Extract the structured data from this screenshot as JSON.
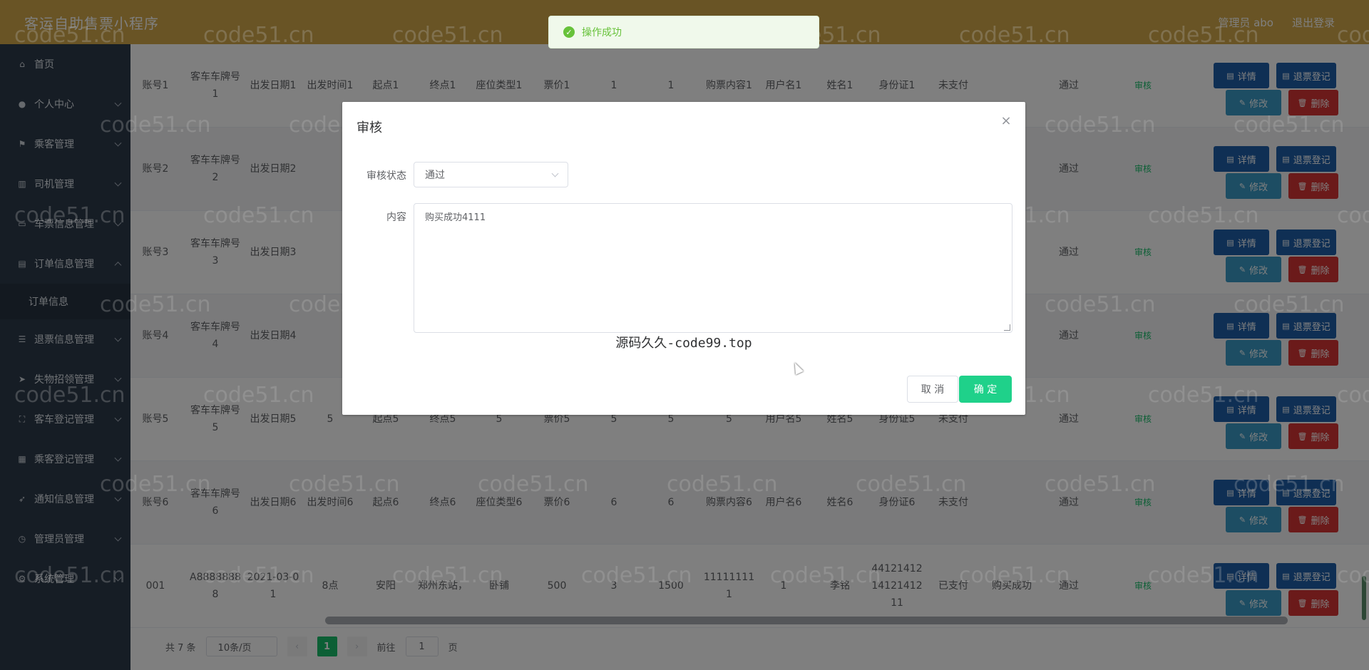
{
  "header": {
    "title": "客运自助售票小程序",
    "user": "管理员 abo",
    "logout": "退出登录"
  },
  "sidebar": {
    "items": [
      {
        "label": "首页",
        "icon": "home-icon"
      },
      {
        "label": "个人中心",
        "icon": "user-icon"
      },
      {
        "label": "乘客管理",
        "icon": "flag-icon"
      },
      {
        "label": "司机管理",
        "icon": "bars-icon"
      },
      {
        "label": "车票信息管理",
        "icon": "ticket-icon"
      },
      {
        "label": "订单信息管理",
        "icon": "doc-icon"
      },
      {
        "label": "退票信息管理",
        "icon": "list-icon"
      },
      {
        "label": "失物招领管理",
        "icon": "send-icon"
      },
      {
        "label": "客车登记管理",
        "icon": "scan-icon"
      },
      {
        "label": "乘客登记管理",
        "icon": "grid-icon"
      },
      {
        "label": "通知信息管理",
        "icon": "nav-icon"
      },
      {
        "label": "管理员管理",
        "icon": "clock-icon"
      },
      {
        "label": "系统管理",
        "icon": "gear-icon"
      }
    ],
    "sub_item": "订单信息"
  },
  "table": {
    "rows": [
      {
        "account": "账号1",
        "plate": "客车车牌号1",
        "date": "出发日期1",
        "time": "出发时间1",
        "from": "起点1",
        "to": "终点1",
        "seat": "座位类型1",
        "price": "票价1",
        "qty": "1",
        "total": "1",
        "content": "购票内容1",
        "username": "用户名1",
        "name": "姓名1",
        "idcard": "身份证1",
        "paid": "未支付",
        "reply": "",
        "status": "通过"
      },
      {
        "account": "账号2",
        "plate": "客车车牌号2",
        "date": "出发日期2",
        "time": "",
        "from": "",
        "to": "",
        "seat": "",
        "price": "",
        "qty": "",
        "total": "",
        "content": "",
        "username": "",
        "name": "",
        "idcard": "",
        "paid": "",
        "reply": "",
        "status": "通过"
      },
      {
        "account": "账号3",
        "plate": "客车车牌号3",
        "date": "出发日期3",
        "time": "",
        "from": "",
        "to": "",
        "seat": "",
        "price": "",
        "qty": "",
        "total": "",
        "content": "",
        "username": "",
        "name": "",
        "idcard": "",
        "paid": "",
        "reply": "",
        "status": "通过"
      },
      {
        "account": "账号4",
        "plate": "客车车牌号4",
        "date": "出发日期4",
        "time": "",
        "from": "",
        "to": "",
        "seat": "",
        "price": "",
        "qty": "",
        "total": "",
        "content": "",
        "username": "",
        "name": "",
        "idcard": "",
        "paid": "",
        "reply": "",
        "status": "通过"
      },
      {
        "account": "账号5",
        "plate": "客车车牌号5",
        "date": "出发日期5",
        "time": "5",
        "from": "起点5",
        "to": "终点5",
        "seat": "5",
        "price": "票价5",
        "qty": "5",
        "total": "5",
        "content": "5",
        "username": "用户名5",
        "name": "姓名5",
        "idcard": "身份证5",
        "paid": "未支付",
        "reply": "",
        "status": "通过"
      },
      {
        "account": "账号6",
        "plate": "客车车牌号6",
        "date": "出发日期6",
        "time": "出发时间6",
        "from": "起点6",
        "to": "终点6",
        "seat": "座位类型6",
        "price": "票价6",
        "qty": "6",
        "total": "6",
        "content": "购票内容6",
        "username": "用户名6",
        "name": "姓名6",
        "idcard": "身份证6",
        "paid": "未支付",
        "reply": "",
        "status": "通过"
      },
      {
        "account": "001",
        "plate": "A88888888",
        "date": "2021-03-01",
        "time": "8点",
        "from": "安阳",
        "to": "郑州东站，",
        "seat": "卧铺",
        "price": "500",
        "qty": "3",
        "total": "1500",
        "content": "111111111",
        "username": "1",
        "name": "李铭",
        "idcard": "441214121412141211",
        "paid": "已支付",
        "reply": "购买成功",
        "status": "通过"
      }
    ],
    "audit_label": "审核",
    "btn_detail": "详情",
    "btn_refund": "退票登记",
    "btn_edit": "修改",
    "btn_delete": "删除"
  },
  "pagination": {
    "total": "共 7 条",
    "page_size": "10条/页",
    "current": "1",
    "goto_prefix": "前往",
    "goto_value": "1",
    "goto_suffix": "页"
  },
  "toast": {
    "message": "操作成功"
  },
  "dialog": {
    "title": "审核",
    "status_label": "审核状态",
    "status_value": "通过",
    "content_label": "内容",
    "content_value": "购买成功4111",
    "caption": "源码久久-code99.top",
    "cancel": "取 消",
    "confirm": "确 定"
  },
  "watermark": "code51.cn"
}
